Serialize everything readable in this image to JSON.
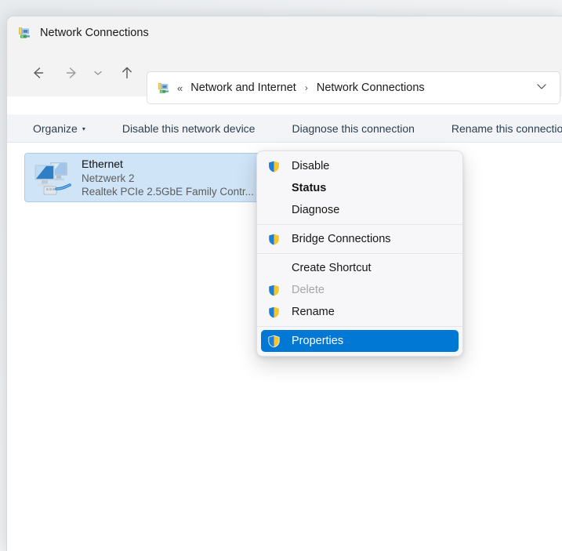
{
  "window": {
    "title": "Network Connections",
    "title_icon": "network-connections-icon"
  },
  "nav": {
    "back_icon": "arrow-left-icon",
    "forward_icon": "arrow-right-icon",
    "recent_icon": "chevron-down-icon",
    "up_icon": "arrow-up-icon"
  },
  "address": {
    "icon": "network-connections-icon",
    "overflow_chevron": "«",
    "crumbs": [
      {
        "label": "Network and Internet"
      },
      {
        "label": "Network Connections"
      }
    ],
    "separator": "›",
    "dropdown_icon": "chevron-down-icon"
  },
  "toolbar": {
    "items": [
      {
        "label": "Organize",
        "caret": "▾"
      },
      {
        "label": "Disable this network device",
        "caret": ""
      },
      {
        "label": "Diagnose this connection",
        "caret": ""
      },
      {
        "label": "Rename this connection",
        "caret": ""
      }
    ]
  },
  "connections": [
    {
      "name": "Ethernet",
      "network": "Netzwerk 2",
      "adapter": "Realtek PCIe 2.5GbE Family Contr...",
      "icon": "ethernet-adapter-icon",
      "selected": true
    }
  ],
  "context_menu": {
    "items": [
      {
        "label": "Disable",
        "icon": "uac-shield-icon",
        "bold": false,
        "disabled": false,
        "selected": false
      },
      {
        "label": "Status",
        "icon": "",
        "bold": true,
        "disabled": false,
        "selected": false
      },
      {
        "label": "Diagnose",
        "icon": "",
        "bold": false,
        "disabled": false,
        "selected": false
      },
      {
        "separator": true
      },
      {
        "label": "Bridge Connections",
        "icon": "uac-shield-icon",
        "bold": false,
        "disabled": false,
        "selected": false
      },
      {
        "separator": true
      },
      {
        "label": "Create Shortcut",
        "icon": "",
        "bold": false,
        "disabled": false,
        "selected": false
      },
      {
        "label": "Delete",
        "icon": "uac-shield-icon",
        "bold": false,
        "disabled": true,
        "selected": false
      },
      {
        "label": "Rename",
        "icon": "uac-shield-icon",
        "bold": false,
        "disabled": false,
        "selected": false
      },
      {
        "separator": true
      },
      {
        "label": "Properties",
        "icon": "uac-shield-icon",
        "bold": false,
        "disabled": false,
        "selected": true
      }
    ]
  },
  "colors": {
    "selection_blue": "#0078d4",
    "item_selected_bg": "#cfe4f7",
    "titlebar_bg": "#f3f3f3",
    "toolbar_bg": "#f2f4f7",
    "menu_bg": "#f7f6f8",
    "toolbar_text": "#2c3e50",
    "disabled_text": "#a6a6a6"
  }
}
